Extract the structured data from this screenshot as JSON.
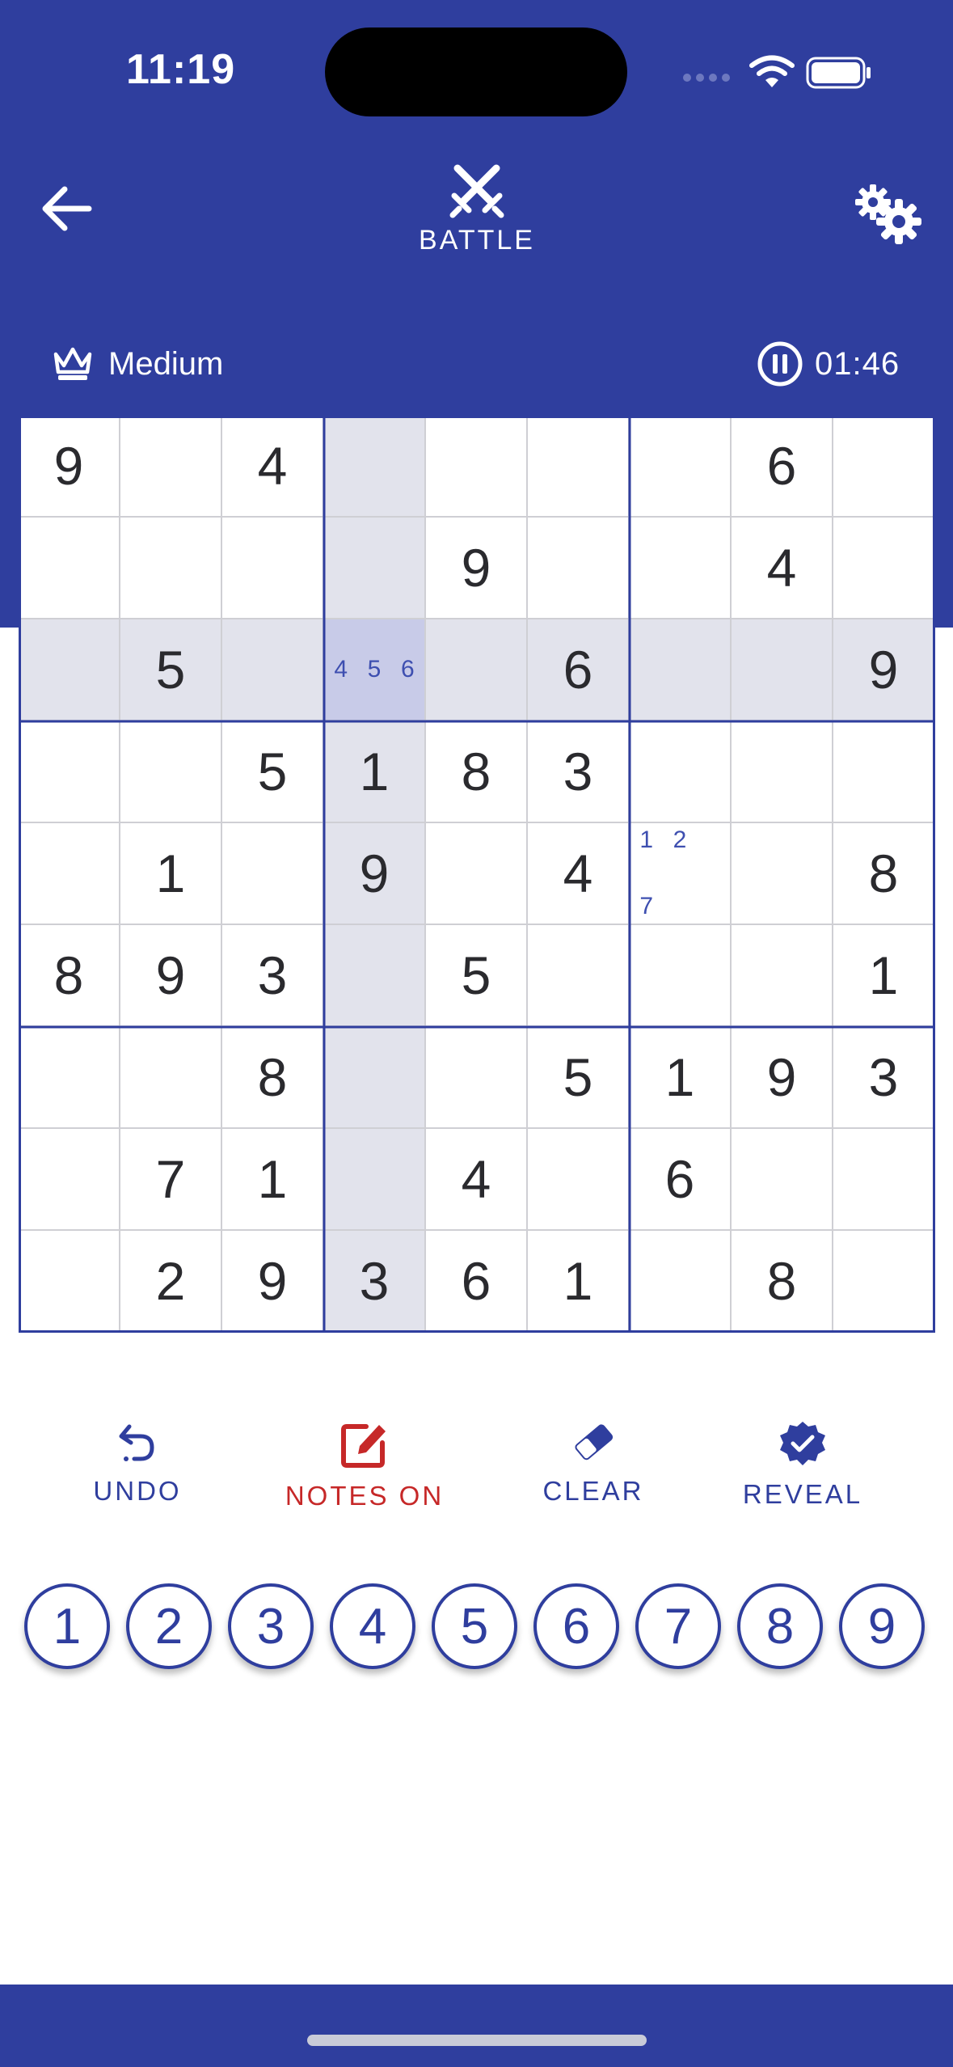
{
  "status_bar": {
    "time": "11:19"
  },
  "header": {
    "title": "BATTLE",
    "back_icon": "arrow-left-icon",
    "mode_icon": "crossed-swords-icon",
    "settings_icon": "gears-icon"
  },
  "info": {
    "difficulty": "Medium",
    "difficulty_icon": "crown-icon",
    "timer": "01:46",
    "timer_icon": "pause-circle-icon"
  },
  "colors": {
    "primary": "#2f3e9e",
    "notes_active": "#c62828",
    "highlight": "#e2e3ec",
    "selected": "#c8cbe8"
  },
  "board": {
    "selected_cell": [
      2,
      3
    ],
    "cells": [
      [
        "9",
        "",
        "4",
        "",
        "",
        "",
        "",
        "6",
        ""
      ],
      [
        "",
        "",
        "",
        "",
        "9",
        "",
        "",
        "4",
        ""
      ],
      [
        "",
        "5",
        "",
        "",
        "",
        "6",
        "",
        "",
        "9"
      ],
      [
        "",
        "",
        "5",
        "1",
        "8",
        "3",
        "",
        "",
        ""
      ],
      [
        "",
        "1",
        "",
        "9",
        "",
        "4",
        "",
        "",
        "8"
      ],
      [
        "8",
        "9",
        "3",
        "",
        "5",
        "",
        "",
        "",
        "1"
      ],
      [
        "",
        "",
        "8",
        "",
        "",
        "5",
        "1",
        "9",
        "3"
      ],
      [
        "",
        "7",
        "1",
        "",
        "4",
        "",
        "6",
        "",
        ""
      ],
      [
        "",
        "2",
        "9",
        "3",
        "6",
        "1",
        "",
        "8",
        ""
      ]
    ],
    "notes": {
      "2,3": [
        "",
        "",
        "",
        "4",
        "5",
        "6",
        "",
        "",
        ""
      ],
      "4,6": [
        "1",
        "2",
        "",
        "",
        "",
        "",
        "7",
        "",
        ""
      ]
    }
  },
  "toolbar": {
    "undo": "UNDO",
    "notes": "NOTES ON",
    "clear": "CLEAR",
    "reveal": "REVEAL"
  },
  "numpad": [
    "1",
    "2",
    "3",
    "4",
    "5",
    "6",
    "7",
    "8",
    "9"
  ]
}
